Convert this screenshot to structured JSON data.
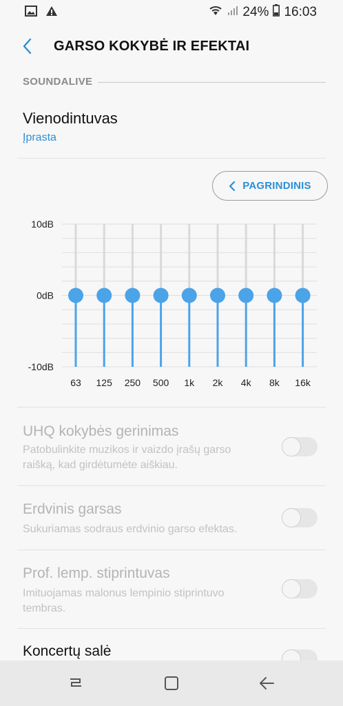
{
  "status_bar": {
    "icons_left": [
      "image-icon",
      "warning-icon"
    ],
    "icons_right": [
      "wifi-icon",
      "signal-icon"
    ],
    "battery": "24%",
    "time": "16:03"
  },
  "header": {
    "title": "GARSO KOKYBĖ IR EFEKTAI"
  },
  "section": {
    "label": "SOUNDALIVE"
  },
  "equalizer": {
    "title": "Vienodintuvas",
    "value": "Įprasta",
    "basic_button_label": "PAGRINDINIS"
  },
  "chart_data": {
    "type": "line",
    "y_labels": [
      "10dB",
      "0dB",
      "-10dB"
    ],
    "ylim": [
      -10,
      10
    ],
    "bands": [
      "63",
      "125",
      "250",
      "500",
      "1k",
      "2k",
      "4k",
      "8k",
      "16k"
    ],
    "values": [
      0,
      0,
      0,
      0,
      0,
      0,
      0,
      0,
      0
    ],
    "colors": {
      "accent": "#4ba3e8",
      "track": "#d9d9d9",
      "grid": "#dedede"
    }
  },
  "settings": [
    {
      "title": "UHQ kokybės gerinimas",
      "desc_lines": [
        "Patobulinkite muzikos ir vaizdo įrašų garso",
        "raišką, kad girdėtumėte aiškiau."
      ],
      "enabled": false
    },
    {
      "title": "Erdvinis garsas",
      "desc_lines": [
        "Sukuriamas sodraus erdvinio garso efektas."
      ],
      "enabled": false
    },
    {
      "title": "Prof. lemp. stiprintuvas",
      "desc_lines": [
        "Imituojamas malonus lempinio stiprintuvo",
        "tembras."
      ],
      "enabled": false
    },
    {
      "title": "Koncertų salė",
      "desc_lines": [],
      "enabled": false
    }
  ],
  "nav_bar": {
    "icons": [
      "recents-icon",
      "home-icon",
      "back-icon"
    ]
  }
}
